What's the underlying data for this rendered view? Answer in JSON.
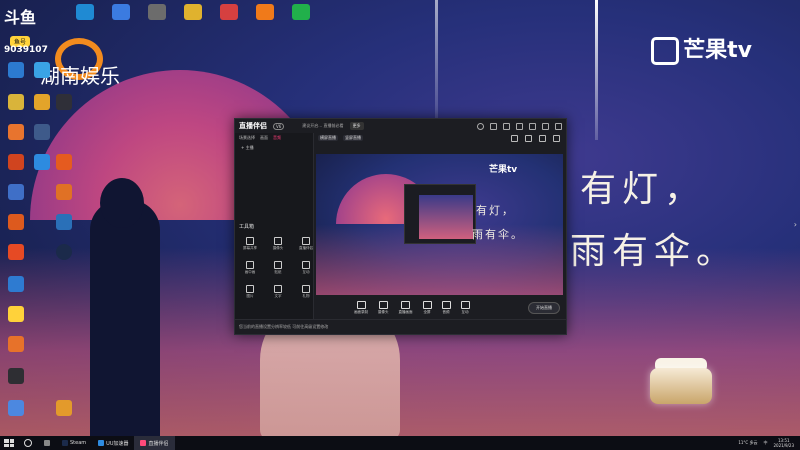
{
  "desktop": {
    "brand_top_left": "斗鱼",
    "badge": "鱼号",
    "id_number": "9039107",
    "hunan_logo": "湖南娱乐",
    "mango_logo": "芒果tv",
    "poem_line1": "有灯，",
    "poem_line2": "雨有伞。"
  },
  "app": {
    "logo": "直播伴侣",
    "version": "V6",
    "notice": "建议开启… 直播前必看",
    "btn_label": "更多",
    "left_tabs": [
      "场景选择",
      "画面",
      "音频"
    ],
    "scene_label": "+ 主播",
    "toolbox_title": "工具箱",
    "tools": [
      "屏幕共享",
      "摄像头",
      "直播伴侣",
      "画中画",
      "贴纸",
      "互动",
      "图片",
      "文字",
      "礼物"
    ],
    "top_segments": [
      "横屏直播",
      "竖屏直播"
    ],
    "preview_mango": "芒果tv",
    "preview_poem1": "有灯，",
    "preview_poem2": "雨有伞。",
    "controls": [
      "画面录制",
      "摄像头",
      "直播画面",
      "全屏",
      "音频",
      "互动"
    ],
    "start_button": "开始直播",
    "bottom_tip": "您当前的直播设置分辨率较低 可前往高级设置修改"
  },
  "taskbar": {
    "items": [
      "Steam",
      "UU加速器",
      "直播伴侣"
    ],
    "weather": "11°C 多云",
    "lang": "中",
    "time": "13:51",
    "date": "2021/9/23"
  }
}
